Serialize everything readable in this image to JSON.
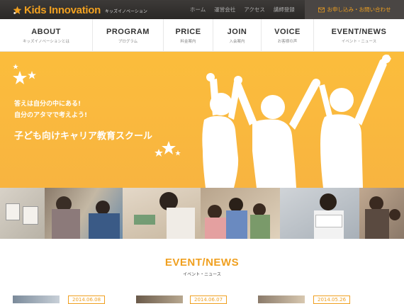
{
  "header": {
    "logo_text": "Kids Innovation",
    "logo_sub": "キッズイノベーション",
    "top_links": [
      "ホーム",
      "運営会社",
      "アクセス",
      "講師登録"
    ],
    "contact_label": "お申し込み・お問い合わせ",
    "accent": "#f0a020"
  },
  "nav": [
    {
      "label": "ABOUT",
      "sub": "キッズイノベーションとは"
    },
    {
      "label": "PROGRAM",
      "sub": "プログラム"
    },
    {
      "label": "PRICE",
      "sub": "料金案内"
    },
    {
      "label": "JOIN",
      "sub": "入会案内"
    },
    {
      "label": "VOICE",
      "sub": "お客様の声"
    },
    {
      "label": "EVENT/NEWS",
      "sub": "イベント・ニュース"
    }
  ],
  "hero": {
    "line1": "答えは自分の中にある!",
    "line2": "自分のアタマで考えよう!",
    "line3": "子ども向けキャリア教育スクール",
    "bg": "#fbbd3c"
  },
  "events": {
    "title": "EVENT/NEWS",
    "sub": "イベント・ニュース",
    "dates": [
      "2014.06.08",
      "2014.06.07",
      "2014.05.26"
    ]
  }
}
